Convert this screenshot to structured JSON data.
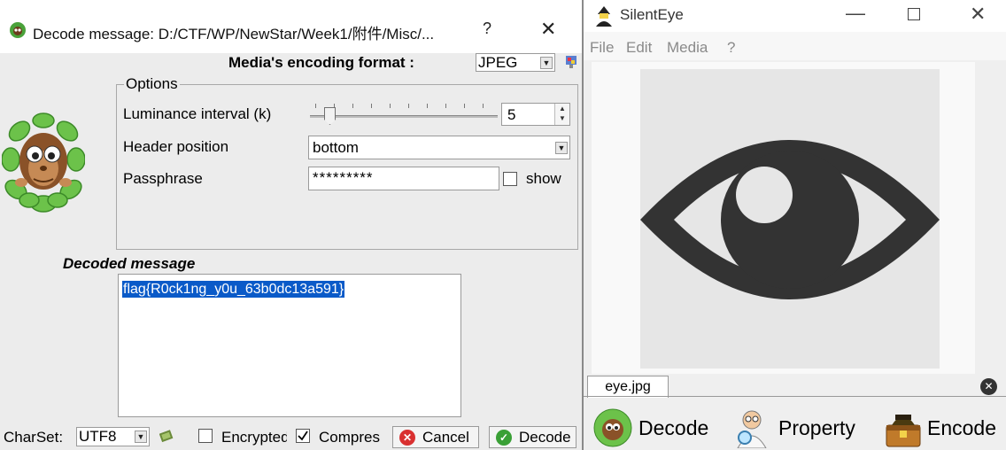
{
  "dialog": {
    "title": "Decode message: D:/CTF/WP/NewStar/Week1/附件/Misc/...",
    "help_glyph": "?",
    "close_glyph": "✕",
    "media_format_label": "Media's encoding format :",
    "media_format_value": "JPEG",
    "options_title": "Options",
    "luminance_label": "Luminance interval (k)",
    "luminance_value": "5",
    "header_label": "Header position",
    "header_value": "bottom",
    "passphrase_label": "Passphrase",
    "passphrase_value": "*********",
    "show_label": "show",
    "show_checked": false,
    "decoded_label": "Decoded message",
    "decoded_text": "flag{R0ck1ng_y0u_63b0dc13a591}",
    "charset_label": "CharSet:",
    "charset_value": "UTF8",
    "encrypted_label": "Encrypted",
    "encrypted_checked": false,
    "compress_label": "Compres",
    "compress_checked": true,
    "cancel_label": "Cancel",
    "decode_label": "Decode"
  },
  "main": {
    "title": "SilentEye",
    "menu": [
      "File",
      "Edit",
      "Media",
      "?"
    ],
    "file_tab": "eye.jpg",
    "actions": [
      "Decode",
      "Property",
      "Encode"
    ]
  },
  "colors": {
    "selection": "#0a5ac8",
    "eye": "#333333",
    "cancel_icon": "#d93030",
    "decode_icon": "#3aa036"
  }
}
